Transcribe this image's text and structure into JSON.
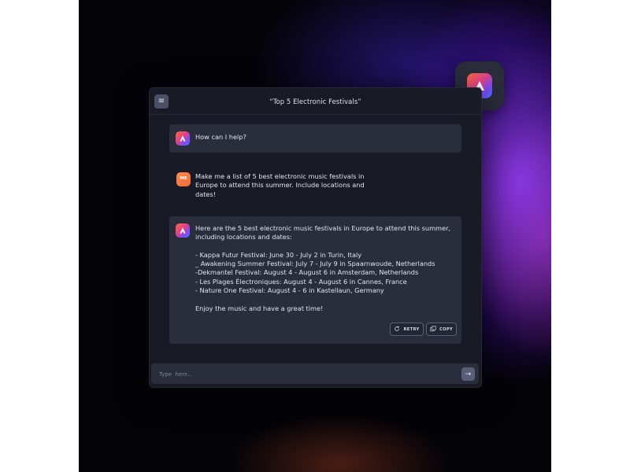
{
  "window": {
    "title": "“Top 5 Electronic Festivals”",
    "menu_icon": "menu-icon"
  },
  "messages": [
    {
      "role": "assistant",
      "text": "How can I help?"
    },
    {
      "role": "user",
      "avatar_label": "ME",
      "text": "Make me a list of 5 best electronic music festivals in\nEurope to attend this summer. Include locations and\ndates!"
    },
    {
      "role": "assistant",
      "text": "Here are the 5 best electronic music festivals in Europe to attend this summer,\nincluding locations and dates:\n\n- Kappa Futur Festival: June 30 - July 2 in Turin, Italy\n_ Awakening Summer Festival: July 7 - July 9 in Spaarnwoude, Netherlands\n-Dekmantel Festival: August 4 - August 6 in Amsterdam, Netherlands\n- Les Plages Électroniques: August 4 - August 6 in Cannes, France\n- Nature One Festival: August 4 - 6 in Kastellaun, Germany\n\nEnjoy the music and have a great time!"
    }
  ],
  "actions": {
    "retry_label": "RETRY",
    "copy_label": "COPY"
  },
  "composer": {
    "placeholder": "Type  here...",
    "value": "",
    "send_icon": "arrow-right-icon"
  },
  "colors": {
    "panel": "#181a26",
    "bubble": "#2a2d3b",
    "accent_orange": "#ff8a4a",
    "accent_purple": "#7a4cff"
  }
}
